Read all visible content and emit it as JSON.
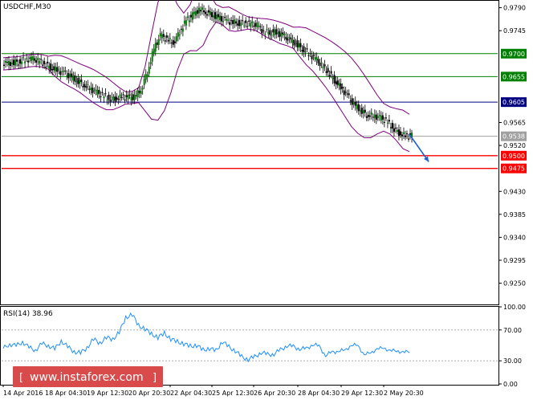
{
  "chart_data": {
    "type": "candlestick",
    "title": "USDCHF,M30",
    "ylim": [
      0.921,
      0.9802
    ],
    "y_ticks": [
      "0.9790",
      "0.9745",
      "0.9700",
      "0.9655",
      "0.9605",
      "0.9565",
      "0.9538",
      "0.9520",
      "0.9500",
      "0.9475",
      "0.9430",
      "0.9385",
      "0.9340",
      "0.9295",
      "0.9250"
    ],
    "x_ticks": [
      "14 Apr 2016",
      "18 Apr 04:30",
      "19 Apr 12:30",
      "20 Apr 20:30",
      "22 Apr 04:30",
      "25 Apr 12:30",
      "26 Apr 20:30",
      "28 Apr 04:30",
      "29 Apr 12:30",
      "2 May 20:30"
    ],
    "grid": false,
    "price_close": [
      0.968,
      0.9682,
      0.9684,
      0.9688,
      0.969,
      0.9686,
      0.968,
      0.9673,
      0.9667,
      0.9662,
      0.9655,
      0.9648,
      0.964,
      0.9632,
      0.9625,
      0.9618,
      0.9612,
      0.9612,
      0.9615,
      0.9614,
      0.9615,
      0.963,
      0.9665,
      0.971,
      0.9735,
      0.9728,
      0.9721,
      0.9743,
      0.9765,
      0.9775,
      0.9787,
      0.9782,
      0.9777,
      0.977,
      0.9765,
      0.9762,
      0.976,
      0.976,
      0.9758,
      0.9755,
      0.9743,
      0.9742,
      0.9742,
      0.9735,
      0.9727,
      0.972,
      0.971,
      0.97,
      0.969,
      0.9677,
      0.9664,
      0.9648,
      0.9633,
      0.9617,
      0.96,
      0.959,
      0.958,
      0.9578,
      0.9575,
      0.9568,
      0.9555,
      0.9545,
      0.9538,
      0.954
    ],
    "levels": [
      {
        "value": 0.97,
        "label": "0.9700",
        "color": "#008000"
      },
      {
        "value": 0.9655,
        "label": "0.9655",
        "color": "#008000"
      },
      {
        "value": 0.9605,
        "label": "0.9605",
        "color": "#000080"
      },
      {
        "value": 0.9538,
        "label": "0.9538",
        "color": "#a0a0a0"
      },
      {
        "value": 0.95,
        "label": "0.9500",
        "color": "#ff0000"
      },
      {
        "value": 0.9475,
        "label": "0.9475",
        "color": "#ff0000"
      }
    ],
    "forecast_arrow": {
      "from": [
        63,
        0.9542
      ],
      "to": [
        66,
        0.9488
      ],
      "color": "#1a5fd0"
    },
    "rsi": {
      "label": "RSI(14) 38.96",
      "ylim": [
        0,
        100
      ],
      "ticks": [
        "100.00",
        "70.00",
        "30.00",
        "0.00"
      ],
      "levels": [
        70,
        30
      ],
      "values": [
        46,
        52,
        49,
        55,
        47,
        44,
        52,
        50,
        45,
        56,
        48,
        42,
        40,
        47,
        58,
        53,
        60,
        58,
        67,
        86,
        90,
        76,
        71,
        65,
        60,
        66,
        58,
        55,
        52,
        49,
        50,
        44,
        46,
        43,
        55,
        48,
        43,
        35,
        32,
        35,
        41,
        38,
        39,
        44,
        50,
        48,
        46,
        45,
        52,
        48,
        38,
        40,
        44,
        42,
        52,
        48,
        40,
        38,
        48,
        44,
        46,
        40,
        44,
        38.96
      ]
    }
  },
  "watermark": {
    "text": "www.instaforex.com"
  }
}
